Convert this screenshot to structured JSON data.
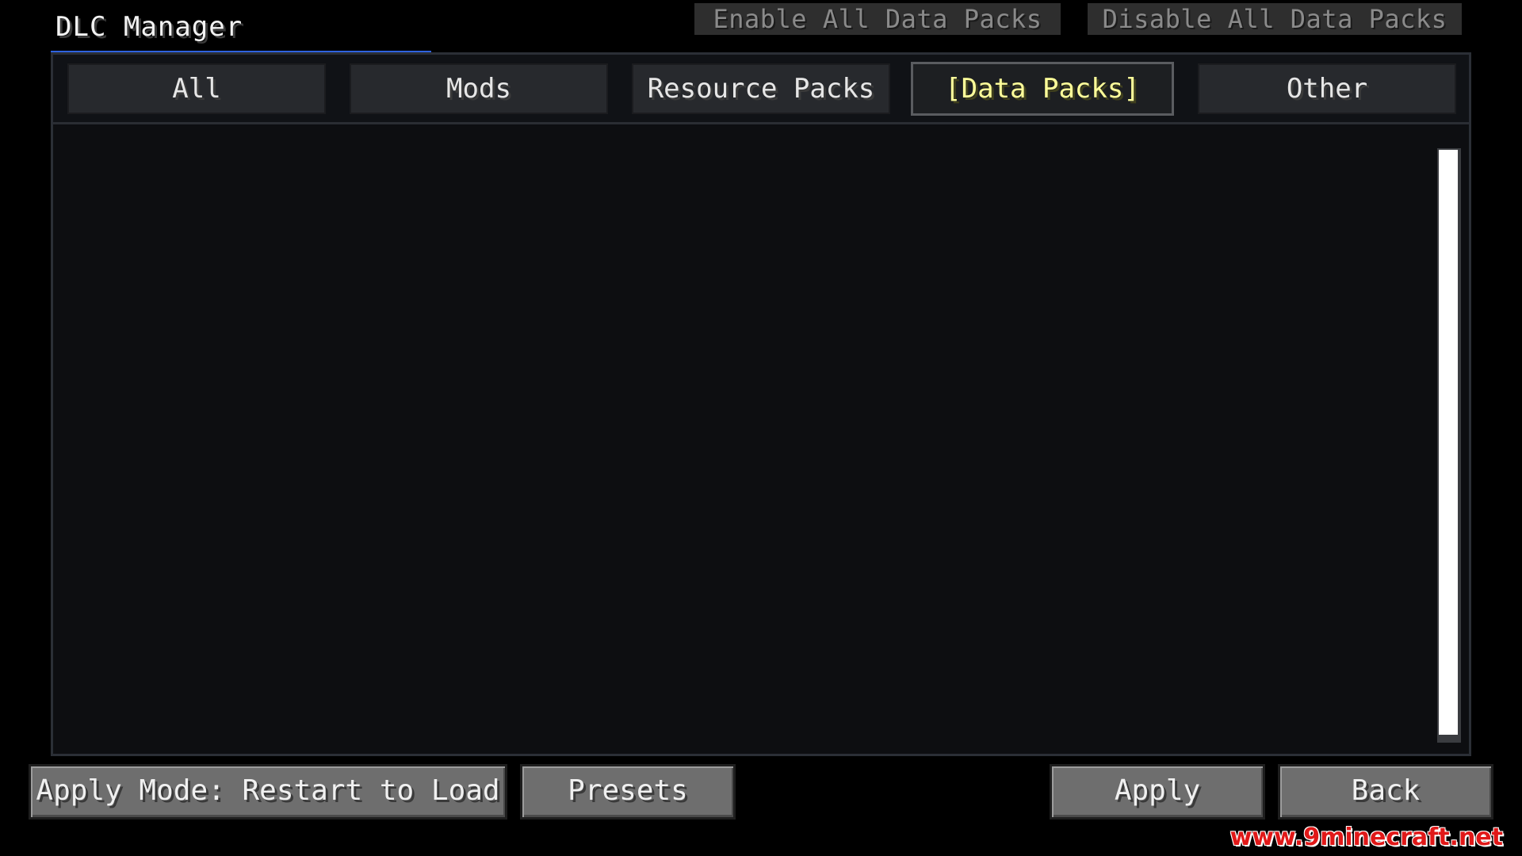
{
  "header": {
    "title": "DLC Manager",
    "enable_all_label": "Enable All Data Packs",
    "disable_all_label": "Disable All Data Packs"
  },
  "tabs": [
    {
      "label": "All",
      "selected": false
    },
    {
      "label": "Mods",
      "selected": false
    },
    {
      "label": "Resource Packs",
      "selected": false
    },
    {
      "label": "[Data Packs]",
      "selected": true
    },
    {
      "label": "Other",
      "selected": false
    }
  ],
  "footer": {
    "apply_mode_label": "Apply Mode: Restart to Load",
    "presets_label": "Presets",
    "apply_label": "Apply",
    "back_label": "Back"
  },
  "watermark": "www.9minecraft.net",
  "colors": {
    "accent_underline": "#2f63e0",
    "selected_tab_text": "#ffff9a",
    "watermark": "#e01818"
  }
}
